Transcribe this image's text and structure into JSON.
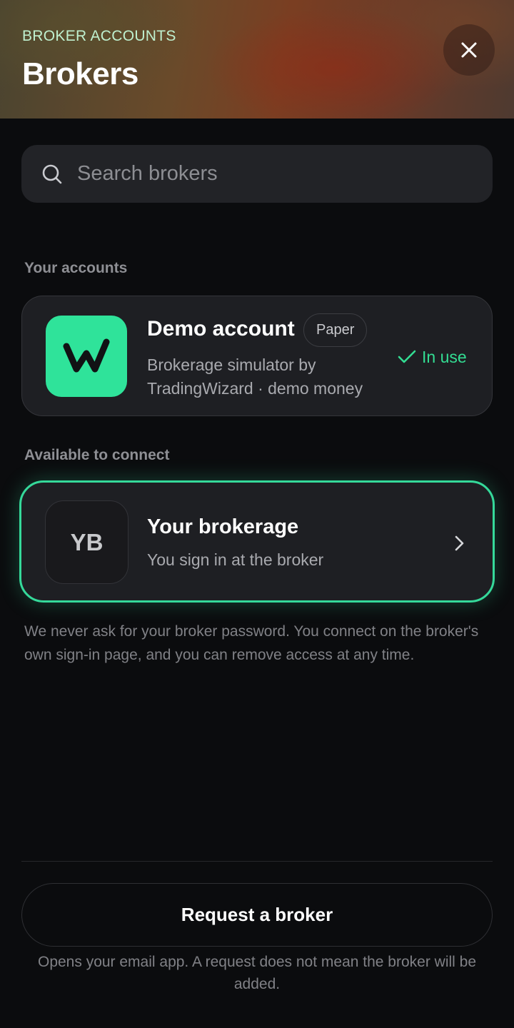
{
  "header": {
    "eyebrow": "BROKER ACCOUNTS",
    "title": "Brokers",
    "close_icon": "close-icon"
  },
  "search": {
    "placeholder": "Search brokers",
    "value": "",
    "icon": "search-icon"
  },
  "your_accounts": {
    "label": "Your accounts",
    "items": [
      {
        "logo_letter": "W",
        "logo_color": "#2fe39a",
        "name": "Demo account",
        "badge": "Paper",
        "description": "Brokerage simulator by TradingWizard · demo money",
        "status": "In use",
        "status_color": "#33dd93",
        "status_icon": "check-icon"
      }
    ]
  },
  "available": {
    "label": "Available to connect",
    "items": [
      {
        "initials": "YB",
        "title": "Your brokerage",
        "subtitle": "You sign in at the broker",
        "accent_color": "#35d99a",
        "icon": "chevron-right-icon"
      }
    ]
  },
  "privacy_note": "We never ask for your broker password. You connect on the broker's own sign-in page, and you can remove access at any time.",
  "request": {
    "button_label": "Request a broker",
    "note": "Opens your email app. A request does not mean the broker will be added."
  }
}
